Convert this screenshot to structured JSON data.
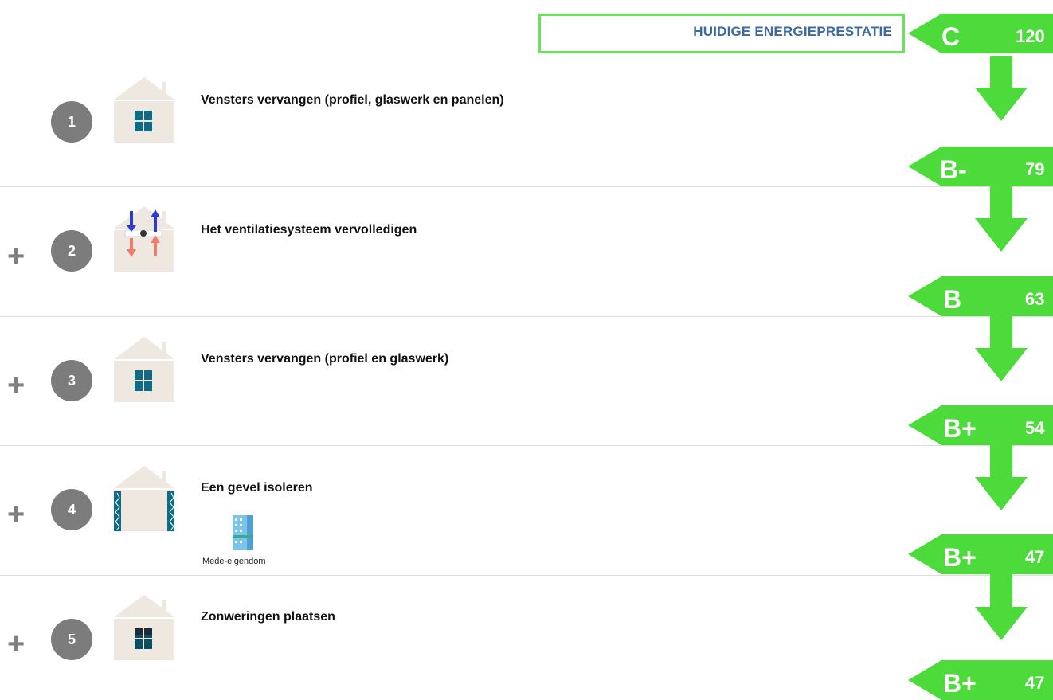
{
  "header": {
    "title": "HUIDIGE ENERGIEPRESTATIE",
    "current_class": "C",
    "current_value": "120"
  },
  "steps": [
    {
      "number": "1",
      "prefix": "",
      "title": "Vensters vervangen (profiel, glaswerk en panelen)",
      "icon": "house-window-icon",
      "result_class": "B-",
      "result_value": "79"
    },
    {
      "number": "2",
      "prefix": "+",
      "title": "Het ventilatiesysteem vervolledigen",
      "icon": "house-ventilation-icon",
      "result_class": "B",
      "result_value": "63"
    },
    {
      "number": "3",
      "prefix": "+",
      "title": "Vensters vervangen (profiel en glaswerk)",
      "icon": "house-window-icon",
      "result_class": "B+",
      "result_value": "54"
    },
    {
      "number": "4",
      "prefix": "+",
      "title": "Een gevel isoleren",
      "icon": "house-facade-insulation-icon",
      "sub_icon": "building-icon",
      "sub_label": "Mede-eigendom",
      "result_class": "B+",
      "result_value": "47"
    },
    {
      "number": "5",
      "prefix": "+",
      "title": "Zonweringen plaatsen",
      "icon": "house-sunshade-icon",
      "result_class": "B+",
      "result_value": "47"
    }
  ],
  "colors": {
    "green": "#4ddb3c",
    "green_border": "#68e35a",
    "header_text": "#3d6b9f",
    "badge_grey": "#7c7c7c",
    "window_blue": "#0e6b86",
    "house_wall": "#efe8e1"
  }
}
